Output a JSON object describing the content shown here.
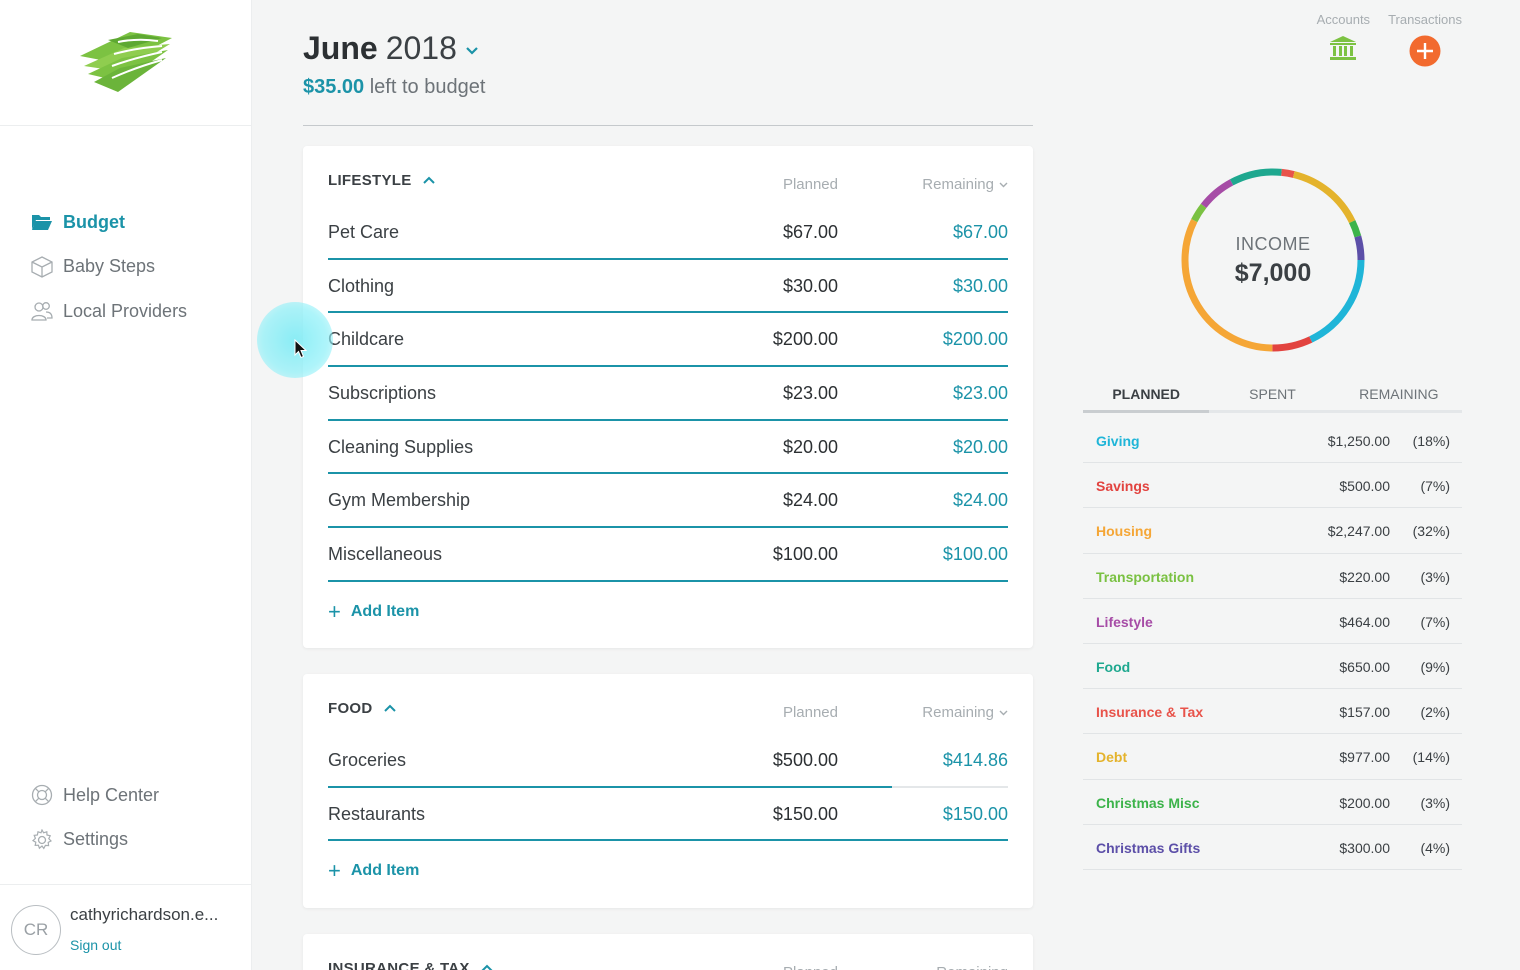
{
  "sidebar": {
    "nav": [
      {
        "label": "Budget",
        "icon": "folder-open-icon",
        "active": true
      },
      {
        "label": "Baby Steps",
        "icon": "box-icon"
      },
      {
        "label": "Local Providers",
        "icon": "people-icon"
      }
    ],
    "bottom": [
      {
        "label": "Help Center",
        "icon": "lifebuoy-icon"
      },
      {
        "label": "Settings",
        "icon": "gear-icon"
      }
    ],
    "user": {
      "initials": "CR",
      "email": "cathyrichardson.e...",
      "signout": "Sign out"
    }
  },
  "header": {
    "month": "June",
    "year": "2018",
    "left_amount": "$35.00",
    "left_text": "left to budget",
    "accounts_label": "Accounts",
    "transactions_label": "Transactions"
  },
  "columns": {
    "planned": "Planned",
    "remaining": "Remaining"
  },
  "add_item": "Add Item",
  "groups": [
    {
      "title": "LIFESTYLE",
      "items": [
        {
          "name": "Pet Care",
          "planned": "$67.00",
          "remaining": "$67.00",
          "progress": 1.0
        },
        {
          "name": "Clothing",
          "planned": "$30.00",
          "remaining": "$30.00",
          "progress": 1.0
        },
        {
          "name": "Childcare",
          "planned": "$200.00",
          "remaining": "$200.00",
          "progress": 1.0
        },
        {
          "name": "Subscriptions",
          "planned": "$23.00",
          "remaining": "$23.00",
          "progress": 1.0
        },
        {
          "name": "Cleaning Supplies",
          "planned": "$20.00",
          "remaining": "$20.00",
          "progress": 1.0
        },
        {
          "name": "Gym Membership",
          "planned": "$24.00",
          "remaining": "$24.00",
          "progress": 1.0
        },
        {
          "name": "Miscellaneous",
          "planned": "$100.00",
          "remaining": "$100.00",
          "progress": 1.0
        }
      ]
    },
    {
      "title": "FOOD",
      "items": [
        {
          "name": "Groceries",
          "planned": "$500.00",
          "remaining": "$414.86",
          "progress": 0.83
        },
        {
          "name": "Restaurants",
          "planned": "$150.00",
          "remaining": "$150.00",
          "progress": 1.0
        }
      ]
    },
    {
      "title": "INSURANCE & TAX",
      "items": []
    }
  ],
  "income": {
    "label": "INCOME",
    "value": "$7,000"
  },
  "tabs": [
    "PLANNED",
    "SPENT",
    "REMAINING"
  ],
  "summary": [
    {
      "name": "Giving",
      "amount": "$1,250.00",
      "pct": "(18%)",
      "color": "#1fb5d8"
    },
    {
      "name": "Savings",
      "amount": "$500.00",
      "pct": "(7%)",
      "color": "#e2433f"
    },
    {
      "name": "Housing",
      "amount": "$2,247.00",
      "pct": "(32%)",
      "color": "#f5a636"
    },
    {
      "name": "Transportation",
      "amount": "$220.00",
      "pct": "(3%)",
      "color": "#7ac142"
    },
    {
      "name": "Lifestyle",
      "amount": "$464.00",
      "pct": "(7%)",
      "color": "#a64ca6"
    },
    {
      "name": "Food",
      "amount": "$650.00",
      "pct": "(9%)",
      "color": "#1ea88f"
    },
    {
      "name": "Insurance & Tax",
      "amount": "$157.00",
      "pct": "(2%)",
      "color": "#e8534a"
    },
    {
      "name": "Debt",
      "amount": "$977.00",
      "pct": "(14%)",
      "color": "#e4b32c"
    },
    {
      "name": "Christmas Misc",
      "amount": "$200.00",
      "pct": "(3%)",
      "color": "#3cb34a"
    },
    {
      "name": "Christmas Gifts",
      "amount": "$300.00",
      "pct": "(4%)",
      "color": "#5c4fa8"
    }
  ]
}
